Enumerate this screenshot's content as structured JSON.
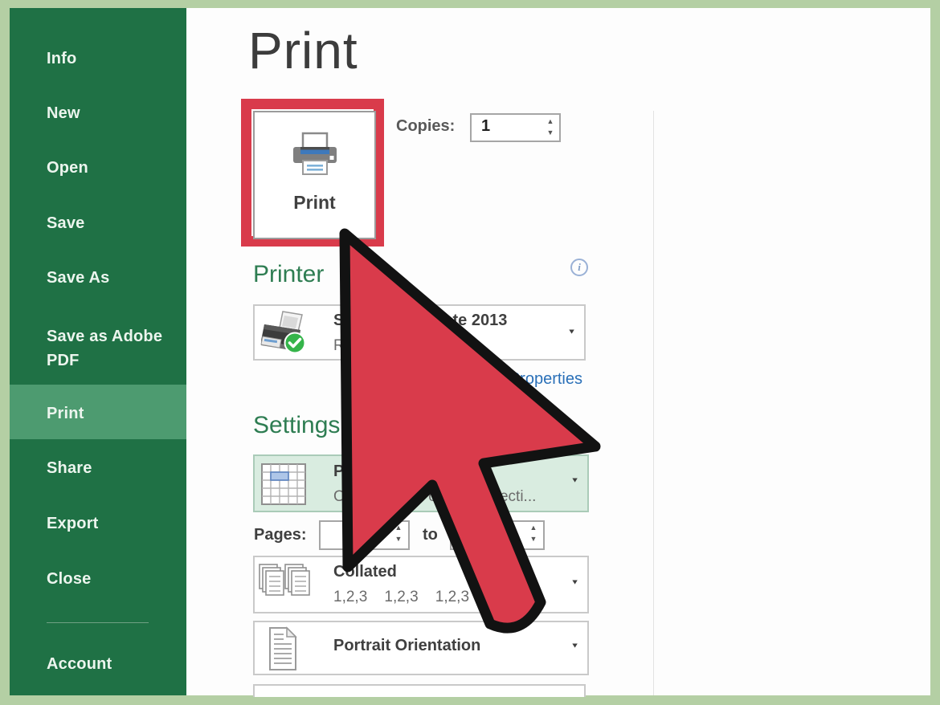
{
  "sidebar": {
    "items": [
      {
        "label": "Info",
        "active": false
      },
      {
        "label": "New",
        "active": false
      },
      {
        "label": "Open",
        "active": false
      },
      {
        "label": "Save",
        "active": false
      },
      {
        "label": "Save As",
        "active": false
      },
      {
        "label": "Save as Adobe PDF",
        "active": false
      },
      {
        "label": "Print",
        "active": true
      },
      {
        "label": "Share",
        "active": false
      },
      {
        "label": "Export",
        "active": false
      },
      {
        "label": "Close",
        "active": false
      },
      {
        "label": "Account",
        "active": false
      }
    ]
  },
  "main": {
    "title": "Print",
    "print_button": {
      "label": "Print"
    },
    "copies": {
      "label": "Copies:",
      "value": "1"
    },
    "printer": {
      "heading": "Printer",
      "selected_name": "Send To OneNote 2013",
      "status": "Ready",
      "properties_link": "Printer Properties"
    },
    "settings": {
      "heading": "Settings",
      "what_to_print": {
        "title": "Print Selection",
        "description": "Only print the current selecti..."
      },
      "pages": {
        "label": "Pages:",
        "from_value": "",
        "to_label": "to",
        "to_value": ""
      },
      "collation": {
        "title": "Collated",
        "subtitle": "1,2,3    1,2,3    1,2,3"
      },
      "orientation": {
        "title": "Portrait Orientation"
      }
    }
  },
  "icons": {
    "caret_down": "▼",
    "spinner_up": "▲",
    "spinner_down": "▼",
    "info": "i"
  },
  "colors": {
    "frame_green": "#b4cfa4",
    "sidebar_green": "#1f7145",
    "sidebar_highlight": "#4d9b70",
    "heading_green": "#2e7d52",
    "highlight_red": "#d93b4b",
    "link_blue": "#2a70b8",
    "settings_highlight_bg": "#d9ece0"
  }
}
